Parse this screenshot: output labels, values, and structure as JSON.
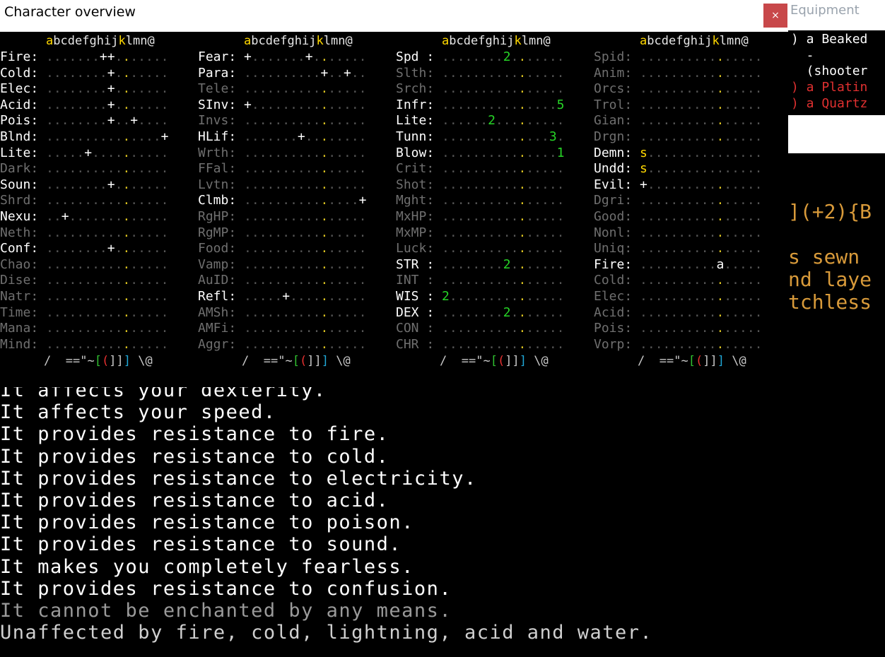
{
  "window": {
    "title": "Character overview",
    "close_label": "×"
  },
  "background": {
    "equipment_title": "Equipment",
    "equipment_lines": [
      {
        "text": ") a Beaked",
        "color": "#ffffff"
      },
      {
        "text": "  -",
        "color": "#ffffff"
      },
      {
        "text": "  (shooter",
        "color": "#ffffff"
      },
      {
        "text": ") a Platin",
        "color": "#e03030"
      },
      {
        "text": ") a Quartz",
        "color": "#e03030"
      }
    ],
    "orange_lines": [
      "](+2){B",
      "s sewn",
      "nd laye",
      "tchless"
    ],
    "description": [
      {
        "text": "It affects your dexterity.",
        "style": "white"
      },
      {
        "text": "It affects your speed.",
        "style": "white"
      },
      {
        "text": "It provides resistance to fire.",
        "style": "white"
      },
      {
        "text": "It provides resistance to cold.",
        "style": "white"
      },
      {
        "text": "It provides resistance to electricity.",
        "style": "white"
      },
      {
        "text": "It provides resistance to acid.",
        "style": "white"
      },
      {
        "text": "It provides resistance to poison.",
        "style": "white"
      },
      {
        "text": "It provides resistance to sound.",
        "style": "white"
      },
      {
        "text": "It makes you completely fearless.",
        "style": "white"
      },
      {
        "text": "It provides resistance to confusion.",
        "style": "white"
      },
      {
        "text": "It cannot be enchanted by any means.",
        "style": "dim"
      },
      {
        "text": "Unaffected by fire, cold, lightning, acid and water.",
        "style": "gray"
      }
    ]
  },
  "slot_header": "abcdefghijklmn@",
  "footer": "/  ==\"~[(]]] \\@",
  "panels": [
    {
      "rows": [
        {
          "label": "Fire:",
          "dim": false,
          "cells": ".......++.y....."
        },
        {
          "label": "Cold:",
          "dim": false,
          "cells": "........+.y....."
        },
        {
          "label": "Elec:",
          "dim": false,
          "cells": "........+.y....."
        },
        {
          "label": "Acid:",
          "dim": false,
          "cells": "........+.y....."
        },
        {
          "label": "Pois:",
          "dim": false,
          "cells": "........+..+...."
        },
        {
          "label": "Blnd:",
          "dim": false,
          "cells": "..........y....+"
        },
        {
          "label": "Lite:",
          "dim": false,
          "cells": ".....+....y....."
        },
        {
          "label": "Dark:",
          "dim": true,
          "cells": "..........y....."
        },
        {
          "label": "Soun:",
          "dim": false,
          "cells": "........+.y....."
        },
        {
          "label": "Shrd:",
          "dim": true,
          "cells": "..........y....."
        },
        {
          "label": "Nexu:",
          "dim": false,
          "cells": "..+.......y....."
        },
        {
          "label": "Neth:",
          "dim": true,
          "cells": "..........y....."
        },
        {
          "label": "Conf:",
          "dim": false,
          "cells": "........+.y....."
        },
        {
          "label": "Chao:",
          "dim": true,
          "cells": "..........y....."
        },
        {
          "label": "Dise:",
          "dim": true,
          "cells": "..........y....."
        },
        {
          "label": "Natr:",
          "dim": true,
          "cells": "..........y....."
        },
        {
          "label": "Time:",
          "dim": true,
          "cells": "..........y....."
        },
        {
          "label": "Mana:",
          "dim": true,
          "cells": "..........y....."
        },
        {
          "label": "Mind:",
          "dim": true,
          "cells": "..........y....."
        }
      ]
    },
    {
      "rows": [
        {
          "label": "Fear:",
          "dim": false,
          "cells": "+.......+.y....."
        },
        {
          "label": "Para:",
          "dim": false,
          "cells": "..........+..+.."
        },
        {
          "label": "Tele:",
          "dim": true,
          "cells": "..........y....."
        },
        {
          "label": "SInv:",
          "dim": false,
          "cells": "+.........y....."
        },
        {
          "label": "Invs:",
          "dim": true,
          "cells": "..........y....."
        },
        {
          "label": "HLif:",
          "dim": false,
          "cells": ".......+..y....."
        },
        {
          "label": "Wrth:",
          "dim": true,
          "cells": "..........y....."
        },
        {
          "label": "FFal:",
          "dim": true,
          "cells": "..........y....."
        },
        {
          "label": "Lvtn:",
          "dim": true,
          "cells": "..........y....."
        },
        {
          "label": "Clmb:",
          "dim": false,
          "cells": "..........y....+"
        },
        {
          "label": "RgHP:",
          "dim": true,
          "cells": "..........y....."
        },
        {
          "label": "RgMP:",
          "dim": true,
          "cells": "..........y....."
        },
        {
          "label": "Food:",
          "dim": true,
          "cells": "..........y....."
        },
        {
          "label": "Vamp:",
          "dim": true,
          "cells": "..........y....."
        },
        {
          "label": "AuID:",
          "dim": true,
          "cells": "..........y....."
        },
        {
          "label": "Refl:",
          "dim": false,
          "cells": ".....+....y....."
        },
        {
          "label": "AMSh:",
          "dim": true,
          "cells": "..........y....."
        },
        {
          "label": "AMFi:",
          "dim": true,
          "cells": "..........y....."
        },
        {
          "label": "Aggr:",
          "dim": true,
          "cells": "..........y....."
        }
      ]
    },
    {
      "rows": [
        {
          "label": "Spd :",
          "dim": false,
          "cells": "........2.y....."
        },
        {
          "label": "Slth:",
          "dim": true,
          "cells": "..........y....."
        },
        {
          "label": "Srch:",
          "dim": true,
          "cells": "..........y....."
        },
        {
          "label": "Infr:",
          "dim": false,
          "cells": "..........y....5"
        },
        {
          "label": "Lite:",
          "dim": false,
          "cells": "......2...y....."
        },
        {
          "label": "Tunn:",
          "dim": false,
          "cells": "..........y...3."
        },
        {
          "label": "Blow:",
          "dim": false,
          "cells": "..........y....1"
        },
        {
          "label": "Crit:",
          "dim": true,
          "cells": "..........y....."
        },
        {
          "label": "Shot:",
          "dim": true,
          "cells": "..........y....."
        },
        {
          "label": "Mght:",
          "dim": true,
          "cells": "..........y....."
        },
        {
          "label": "MxHP:",
          "dim": true,
          "cells": "..........y....."
        },
        {
          "label": "MxMP:",
          "dim": true,
          "cells": "..........y....."
        },
        {
          "label": "Luck:",
          "dim": true,
          "cells": "..........y....."
        },
        {
          "label": "STR :",
          "dim": false,
          "cells": "........2.y....."
        },
        {
          "label": "INT :",
          "dim": true,
          "cells": "..........y....."
        },
        {
          "label": "WIS :",
          "dim": false,
          "cells": "2.........y....."
        },
        {
          "label": "DEX :",
          "dim": false,
          "cells": "........2.y....."
        },
        {
          "label": "CON :",
          "dim": true,
          "cells": "..........y....."
        },
        {
          "label": "CHR :",
          "dim": true,
          "cells": "..........y....."
        }
      ]
    },
    {
      "rows": [
        {
          "label": "Spid:",
          "dim": true,
          "cells": "..........y....."
        },
        {
          "label": "Anim:",
          "dim": true,
          "cells": "..........y....."
        },
        {
          "label": "Orcs:",
          "dim": true,
          "cells": "..........y....."
        },
        {
          "label": "Trol:",
          "dim": true,
          "cells": "..........y....."
        },
        {
          "label": "Gian:",
          "dim": true,
          "cells": "..........y....."
        },
        {
          "label": "Drgn:",
          "dim": true,
          "cells": "..........y....."
        },
        {
          "label": "Demn:",
          "dim": false,
          "cells": "s..............."
        },
        {
          "label": "Undd:",
          "dim": false,
          "cells": "s..............."
        },
        {
          "label": "Evil:",
          "dim": false,
          "cells": "+.........y....."
        },
        {
          "label": "Dgri:",
          "dim": true,
          "cells": "..........y....."
        },
        {
          "label": "Good:",
          "dim": true,
          "cells": "..........y....."
        },
        {
          "label": "Nonl:",
          "dim": true,
          "cells": "..........y....."
        },
        {
          "label": "Uniq:",
          "dim": true,
          "cells": "..........y....."
        },
        {
          "label": "Fire:",
          "dim": false,
          "cells": "..........a....."
        },
        {
          "label": "Cold:",
          "dim": true,
          "cells": "..........y....."
        },
        {
          "label": "Elec:",
          "dim": true,
          "cells": "..........y....."
        },
        {
          "label": "Acid:",
          "dim": true,
          "cells": "..........y....."
        },
        {
          "label": "Pois:",
          "dim": true,
          "cells": "..........y....."
        },
        {
          "label": "Vorp:",
          "dim": true,
          "cells": "..........y....."
        }
      ]
    }
  ]
}
